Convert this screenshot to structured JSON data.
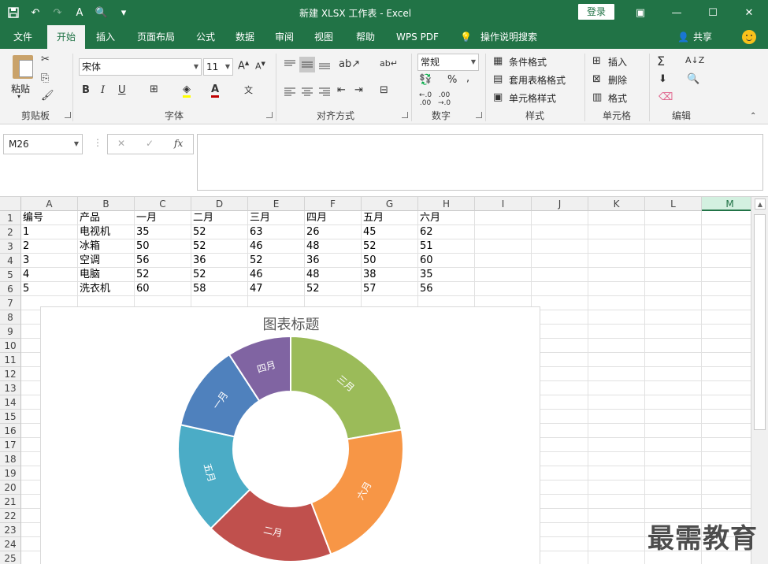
{
  "titlebar": {
    "title": "新建 XLSX 工作表  -  Excel",
    "login": "登录"
  },
  "tabs": [
    "文件",
    "开始",
    "插入",
    "页面布局",
    "公式",
    "数据",
    "审阅",
    "视图",
    "帮助",
    "WPS PDF"
  ],
  "tell_me": "操作说明搜索",
  "share": "共享",
  "ribbon": {
    "paste": "粘贴",
    "font_name": "宋体",
    "font_size": "11",
    "number_format": "常规",
    "conditional_format": "条件格式",
    "table_format": "套用表格格式",
    "cell_style": "单元格样式",
    "insert": "插入",
    "delete": "删除",
    "format": "格式",
    "groups": {
      "clipboard": "剪贴板",
      "font": "字体",
      "alignment": "对齐方式",
      "number": "数字",
      "styles": "样式",
      "cells": "单元格",
      "editing": "编辑"
    }
  },
  "formula_bar": {
    "name_box": "M26",
    "fx": "fx",
    "value": ""
  },
  "sheet": {
    "columns": [
      "A",
      "B",
      "C",
      "D",
      "E",
      "F",
      "G",
      "H",
      "I",
      "J",
      "K",
      "L",
      "M"
    ],
    "selected_column": "M",
    "rows": [
      "1",
      "2",
      "3",
      "4",
      "5",
      "6",
      "7",
      "8",
      "9",
      "10",
      "11",
      "12",
      "13",
      "14",
      "15",
      "16",
      "17",
      "18",
      "19",
      "20",
      "21",
      "22",
      "23",
      "24",
      "25"
    ],
    "cells": [
      [
        "编号",
        "产品",
        "一月",
        "二月",
        "三月",
        "四月",
        "五月",
        "六月"
      ],
      [
        "1",
        "电视机",
        "35",
        "52",
        "63",
        "26",
        "45",
        "62"
      ],
      [
        "2",
        "冰箱",
        "50",
        "52",
        "46",
        "48",
        "52",
        "51"
      ],
      [
        "3",
        "空调",
        "56",
        "36",
        "52",
        "36",
        "50",
        "60"
      ],
      [
        "4",
        "电脑",
        "52",
        "52",
        "46",
        "48",
        "38",
        "35"
      ],
      [
        "5",
        "洗衣机",
        "60",
        "58",
        "47",
        "52",
        "57",
        "56"
      ]
    ]
  },
  "chart_data": {
    "type": "pie",
    "title": "图表标题",
    "categories": [
      "三月",
      "六月",
      "二月",
      "五月",
      "一月",
      "四月"
    ],
    "values": [
      63,
      62,
      52,
      45,
      35,
      26
    ],
    "colors": [
      "#9bbb59",
      "#f79646",
      "#c0504d",
      "#4bacc6",
      "#4f81bd",
      "#8064a2"
    ]
  },
  "watermark": "最需教育"
}
